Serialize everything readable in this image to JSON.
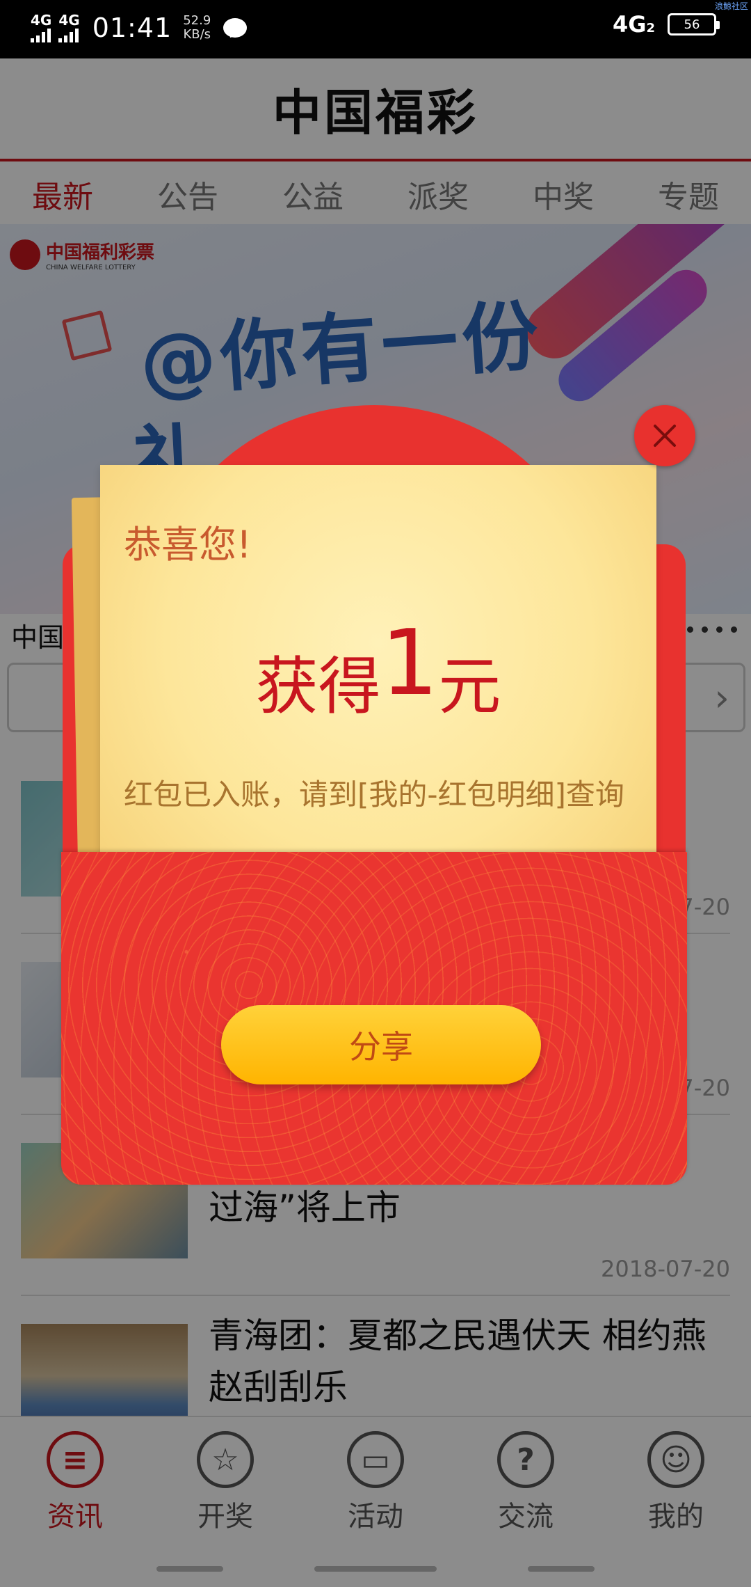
{
  "status_bar": {
    "network1": "4G",
    "network2": "4G",
    "time": "01:41",
    "speed_value": "52.9",
    "speed_unit": "KB/s",
    "mobile_type": "4G",
    "mobile_sub": "2",
    "battery": "56",
    "watermark": "浪鲸社区"
  },
  "header": {
    "title": "中国福彩"
  },
  "tabs": [
    {
      "label": "最新",
      "active": true
    },
    {
      "label": "公告"
    },
    {
      "label": "公益"
    },
    {
      "label": "派奖"
    },
    {
      "label": "中奖"
    },
    {
      "label": "专题"
    }
  ],
  "banner": {
    "logo_text": "中国福利彩票",
    "logo_sub": "CHINA WELFARE LOTTERY",
    "headline": "@你有一份",
    "headline2": "礼"
  },
  "sub_row": {
    "text": "中国"
  },
  "news": [
    {
      "title": "",
      "date": "2018-07-20"
    },
    {
      "title": "",
      "date": "2018-07-20"
    },
    {
      "title": "过海”将上市",
      "date": "2018-07-20"
    },
    {
      "title": "青海团：夏都之民遇伏天 相约燕赵刮刮乐",
      "date": "2018-07-20"
    }
  ],
  "bottom_nav": [
    {
      "label": "资讯",
      "icon": "≡",
      "active": true
    },
    {
      "label": "开奖",
      "icon": "☆"
    },
    {
      "label": "活动",
      "icon": "▭"
    },
    {
      "label": "交流",
      "icon": "?"
    },
    {
      "label": "我的",
      "icon": "☺"
    }
  ],
  "modal": {
    "congrats": "恭喜您!",
    "amount_prefix": "获得",
    "amount_value": "1",
    "amount_suffix": "元",
    "note": "红包已入账，请到[我的-红包明细]查询",
    "share_label": "分享"
  },
  "colors": {
    "brand_red": "#c8161e",
    "packet_red": "#e8322f",
    "share_yellow": "#ffc21a"
  }
}
